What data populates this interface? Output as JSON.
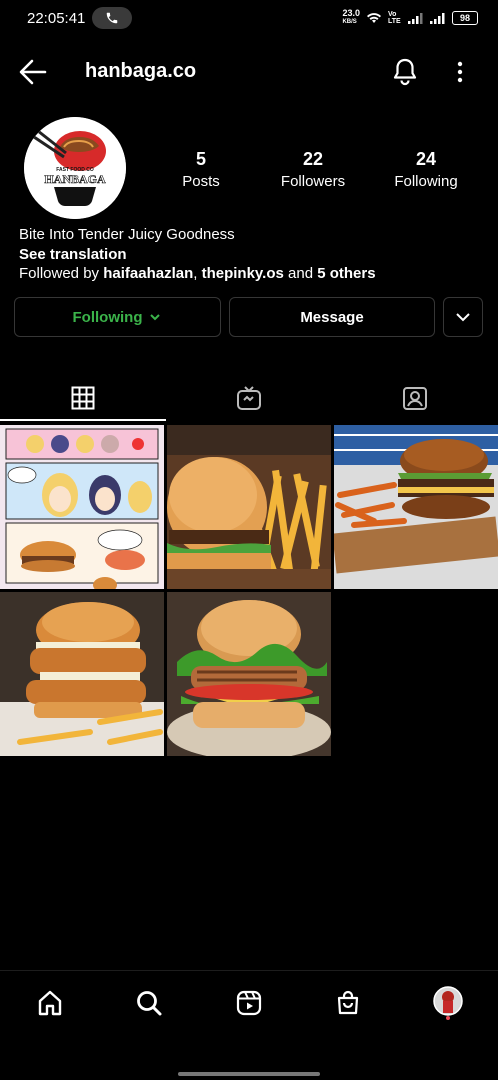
{
  "status": {
    "time": "22:05:41",
    "net_speed_value": "23.0",
    "net_speed_unit": "KB/S",
    "lte_label": "Vo LTE",
    "battery": "98"
  },
  "header": {
    "handle": "hanbaga.co"
  },
  "profile": {
    "logo_top_text": "FAST FOOD CO",
    "logo_name": "HANBAGA",
    "stats": [
      {
        "value": "5",
        "label": "Posts"
      },
      {
        "value": "22",
        "label": "Followers"
      },
      {
        "value": "24",
        "label": "Following"
      }
    ],
    "bio": "Bite Into Tender Juicy Goodness",
    "see_translation": "See translation",
    "followed_by_prefix": "Followed by ",
    "followed_by_user1": "haifaahazlan",
    "followed_by_sep": ", ",
    "followed_by_user2": "thepinky.os",
    "followed_by_and": " and ",
    "followed_by_others": "5 others"
  },
  "actions": {
    "following_label": "Following",
    "message_label": "Message"
  },
  "tabs": [
    "grid-icon",
    "igtv-icon",
    "tagged-icon"
  ],
  "grid": [
    {
      "name": "post-comic",
      "kind": "comic"
    },
    {
      "name": "post-burger-fries",
      "kind": "burger-fries"
    },
    {
      "name": "post-burger-sweet-potato",
      "kind": "burger-board"
    },
    {
      "name": "post-chicken-burger",
      "kind": "chicken-burger"
    },
    {
      "name": "post-burger-lettuce",
      "kind": "burger-lettuce"
    }
  ],
  "bottom_nav": [
    "home-icon",
    "search-icon",
    "reels-icon",
    "shop-icon",
    "profile-avatar"
  ],
  "colors": {
    "following_green": "#3bb34a",
    "background": "#000000",
    "border": "#363636"
  }
}
